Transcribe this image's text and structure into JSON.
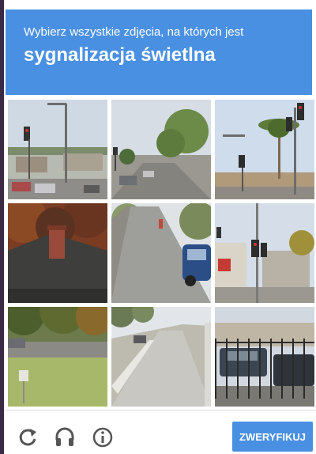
{
  "header": {
    "instruction": "Wybierz wszystkie zdjęcia, na których jest",
    "target": "sygnalizacja świetlna"
  },
  "tiles": [
    {
      "scene": "intersection-traffic-light-cars"
    },
    {
      "scene": "street-with-trees"
    },
    {
      "scene": "traffic-lights-palm-trees"
    },
    {
      "scene": "house-roof-chimney"
    },
    {
      "scene": "road-with-parked-car"
    },
    {
      "scene": "traffic-light-pole-buildings"
    },
    {
      "scene": "road-shoulder-grass"
    },
    {
      "scene": "highway-lanes"
    },
    {
      "scene": "parking-lot-fence"
    }
  ],
  "footer": {
    "icons": [
      "reload-icon",
      "audio-icon",
      "info-icon"
    ],
    "verify_label": "ZWERYFIKUJ"
  },
  "colors": {
    "accent": "#4a90e2",
    "icon": "#555555"
  }
}
